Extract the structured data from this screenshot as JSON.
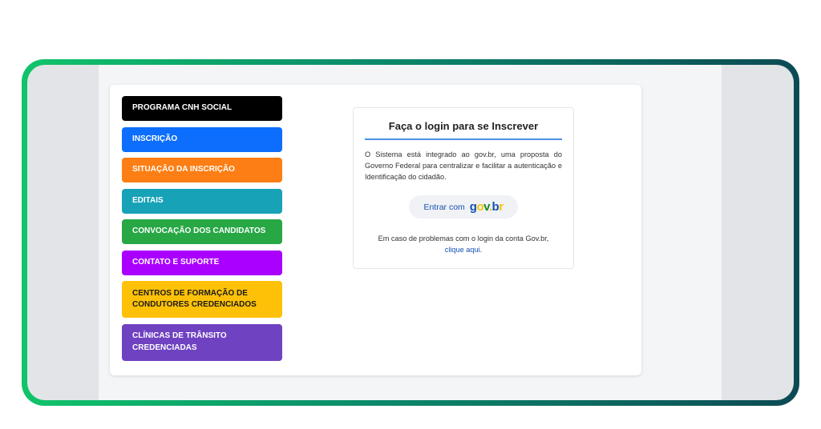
{
  "menu": {
    "items": [
      {
        "label": "PROGRAMA CNH SOCIAL",
        "color": "#000000"
      },
      {
        "label": "INSCRIÇÃO",
        "color": "#0d6efd"
      },
      {
        "label": "SITUAÇÃO DA INSCRIÇÃO",
        "color": "#fd7e14"
      },
      {
        "label": "EDITAIS",
        "color": "#17a2b8"
      },
      {
        "label": "CONVOCAÇÃO DOS CANDIDATOS",
        "color": "#28a745"
      },
      {
        "label": "CONTATO E SUPORTE",
        "color": "#aa00ff"
      },
      {
        "label": "CENTROS DE FORMAÇÃO DE CONDUTORES CREDENCIADOS",
        "color": "#ffc107"
      },
      {
        "label": "CLÍNICAS DE TRÂNSITO CREDENCIADAS",
        "color": "#6f42c1"
      }
    ]
  },
  "login": {
    "title": "Faça o login para se Inscrever",
    "description": "O Sistema está integrado ao gov.br, uma proposta do Governo Federal para centralizar e facilitar a autenticação e Identificação do cidadão.",
    "button_label": "Entrar com",
    "logo_text": "gov.br",
    "problem_text": "Em caso de problemas com o login da conta Gov.br,",
    "help_link": "clique aqui",
    "help_link_suffix": "."
  },
  "colors": {
    "accent": "#4a90e2",
    "frame_gradient_start": "#10c46a",
    "frame_gradient_end": "#0c4a55"
  }
}
